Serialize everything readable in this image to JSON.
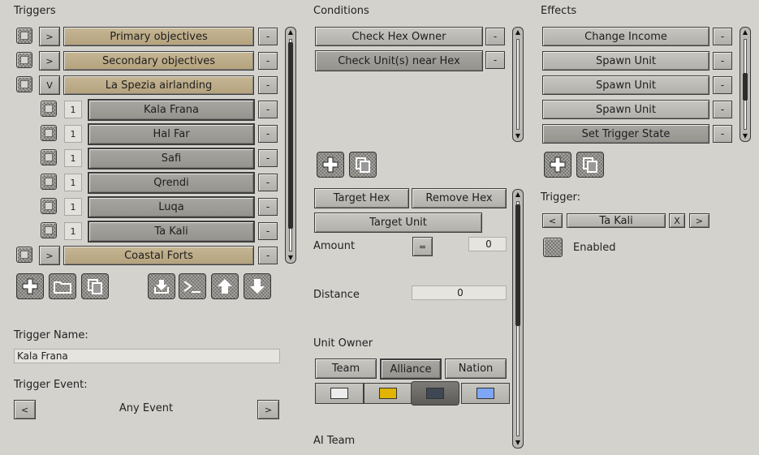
{
  "triggers": {
    "header": "Triggers",
    "rows": [
      {
        "toggle": ">",
        "label": "Primary objectives",
        "group": true
      },
      {
        "toggle": ">",
        "label": "Secondary objectives",
        "group": true
      },
      {
        "toggle": "V",
        "label": "La Spezia airlanding",
        "group": true
      },
      {
        "num": "1",
        "label": "Kala Frana",
        "group": false
      },
      {
        "num": "1",
        "label": "Hal Far",
        "group": false
      },
      {
        "num": "1",
        "label": "Safi",
        "group": false
      },
      {
        "num": "1",
        "label": "Qrendi",
        "group": false
      },
      {
        "num": "1",
        "label": "Luqa",
        "group": false
      },
      {
        "num": "1",
        "label": "Ta Kali",
        "group": false
      },
      {
        "toggle": ">",
        "label": "Coastal Forts",
        "group": true
      }
    ],
    "remove_label": "-",
    "name_label": "Trigger Name:",
    "name_value": "Kala Frana",
    "event_label": "Trigger Event:",
    "event_value": "Any Event",
    "prev": "<",
    "next": ">"
  },
  "conditions": {
    "header": "Conditions",
    "items": [
      "Check Hex Owner",
      "Check Unit(s) near Hex"
    ],
    "remove_label": "-",
    "target_hex": "Target Hex",
    "remove_hex": "Remove Hex",
    "target_unit": "Target Unit",
    "amount_label": "Amount",
    "amount_op": "=",
    "amount_value": "0",
    "distance_label": "Distance",
    "distance_value": "0",
    "unit_owner_label": "Unit Owner",
    "owner_tabs": [
      "Team",
      "Alliance",
      "Nation"
    ],
    "ai_team_label": "AI Team",
    "swatch_colors": [
      "#ececec",
      "#e0b400",
      "#3f4654",
      "#7ea6f4"
    ]
  },
  "effects": {
    "header": "Effects",
    "items": [
      "Change Income",
      "Spawn Unit",
      "Spawn Unit",
      "Spawn Unit",
      "Set Trigger State"
    ],
    "remove_label": "-",
    "trigger_label": "Trigger:",
    "trigger_prev": "<",
    "trigger_value": "Ta Kali",
    "trigger_clear": "X",
    "trigger_next": ">",
    "enabled_label": "Enabled"
  }
}
